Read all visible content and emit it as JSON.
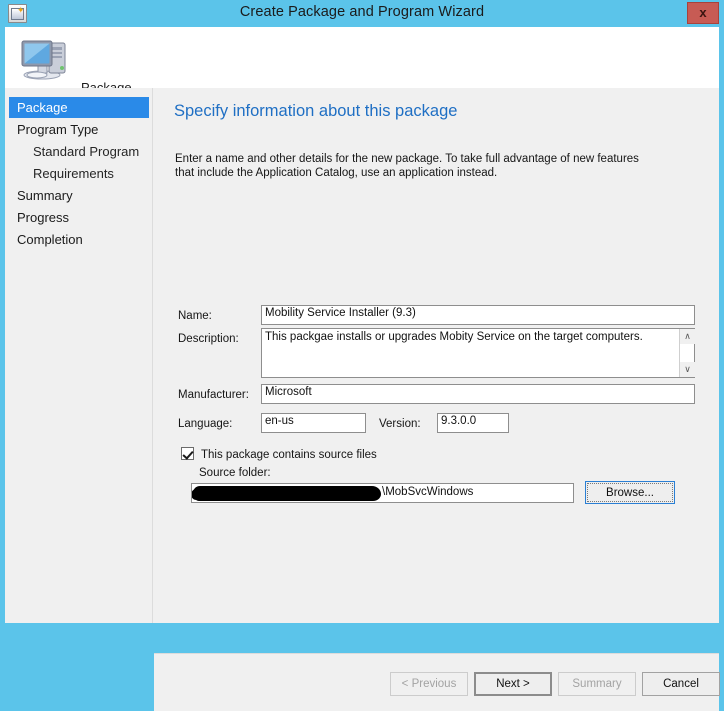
{
  "window": {
    "title": "Create Package and Program Wizard",
    "close_label": "x",
    "title_icon": "package-wizard-icon",
    "accent_color": "#5bc4ea",
    "close_color": "#c75b54"
  },
  "header": {
    "title": "Package",
    "icon": "computer-icon"
  },
  "sidebar": {
    "items": [
      {
        "label": "Package",
        "selected": true,
        "sub": false
      },
      {
        "label": "Program Type",
        "selected": false,
        "sub": false
      },
      {
        "label": "Standard Program",
        "selected": false,
        "sub": true
      },
      {
        "label": "Requirements",
        "selected": false,
        "sub": true
      },
      {
        "label": "Summary",
        "selected": false,
        "sub": false
      },
      {
        "label": "Progress",
        "selected": false,
        "sub": false
      },
      {
        "label": "Completion",
        "selected": false,
        "sub": false
      }
    ],
    "selected_color": "#2a8ae8"
  },
  "content": {
    "page_title": "Specify information about this package",
    "page_title_color": "#1f6fc4",
    "intro": "Enter a name and other details for the new package. To take full advantage of new features that include the Application Catalog, use an application instead.",
    "fields": {
      "name_label": "Name:",
      "name_value": "Mobility Service Installer (9.3)",
      "description_label": "Description:",
      "description_value": "This packgae installs or upgrades Mobity Service on the target computers.",
      "manufacturer_label": "Manufacturer:",
      "manufacturer_value": "Microsoft",
      "language_label": "Language:",
      "language_value": "en-us",
      "version_label": "Version:",
      "version_value": "9.3.0.0"
    },
    "source": {
      "checkbox_label": "This package contains source files",
      "checkbox_checked": true,
      "folder_label": "Source folder:",
      "folder_value": "\\MobSvcWindows",
      "folder_redacted": true,
      "browse_label": "Browse..."
    },
    "scrollbar": {
      "up_arrow": "∧",
      "down_arrow": "∨"
    }
  },
  "footer": {
    "previous_label": "< Previous",
    "previous_disabled": true,
    "next_label": "Next >",
    "next_default": true,
    "summary_label": "Summary",
    "summary_disabled": true,
    "cancel_label": "Cancel"
  }
}
